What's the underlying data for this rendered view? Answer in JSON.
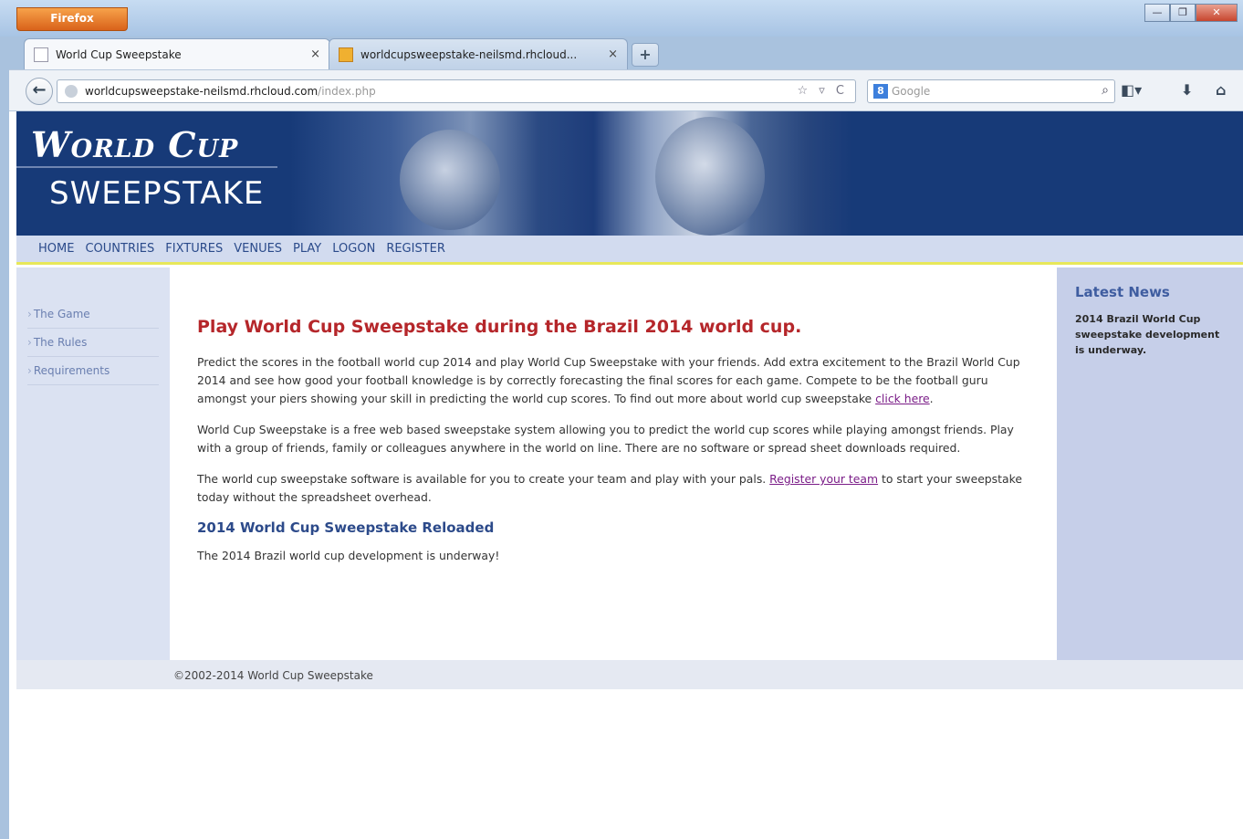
{
  "browser": {
    "menu_button": "Firefox",
    "window_controls": {
      "minimize": "—",
      "maximize": "❐",
      "close": "✕"
    },
    "tabs": [
      {
        "label": "World Cup Sweepstake",
        "close": "×"
      },
      {
        "label": "worldcupsweepstake-neilsmd.rhcloud...",
        "close": "×"
      }
    ],
    "new_tab": "+",
    "url": {
      "host": "worldcupsweepstake-neilsmd.rhcloud.com",
      "path": "/index.php"
    },
    "url_actions": "☆ ▿ C",
    "search": {
      "engine_icon": "8",
      "placeholder": "Google",
      "go": "⌕"
    },
    "tools": {
      "bookmarks": "◧▾",
      "downloads": "⬇",
      "home": "⌂"
    }
  },
  "site": {
    "logo_title": "World Cup",
    "logo_subtitle": "SWEEPSTAKE",
    "nav": [
      "HOME",
      "COUNTRIES",
      "FIXTURES",
      "VENUES",
      "PLAY",
      "LOGON",
      "REGISTER"
    ],
    "sidebar": [
      {
        "label": "The Game"
      },
      {
        "label": "The Rules"
      },
      {
        "label": "Requirements"
      }
    ],
    "main": {
      "heading": "Play World Cup Sweepstake during the Brazil 2014 world cup.",
      "p1_text": "Predict the scores in the football world cup 2014 and play World Cup Sweepstake with your friends. Add extra excitement to the Brazil World Cup 2014 and see how good your football knowledge is by correctly forecasting the final scores for each game. Compete to be the football guru amongst your piers showing your skill in predicting the world cup scores. To find out more about world cup sweepstake ",
      "p1_link": "click here",
      "p1_end": ".",
      "p2": "World Cup Sweepstake is a free web based sweepstake system allowing you to predict the world cup scores while playing amongst friends. Play with a group of friends, family or colleagues anywhere in the world on line. There are no software or spread sheet downloads required.",
      "p3_text": "The world cup sweepstake software is available for you to create your team and play with your pals. ",
      "p3_link": "Register your team",
      "p3_end": " to start your sweepstake today without the spreadsheet overhead.",
      "subheading": "2014 World Cup Sweepstake Reloaded",
      "p4": "The 2014 Brazil world cup development is underway!"
    },
    "news": {
      "title": "Latest News",
      "item": "2014 Brazil World Cup sweepstake development is underway."
    },
    "footer": "©2002-2014 World Cup Sweepstake"
  }
}
